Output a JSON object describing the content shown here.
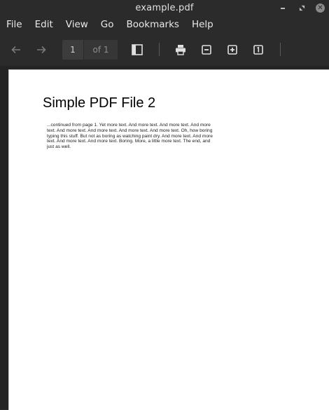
{
  "window": {
    "title": "example.pdf"
  },
  "menu": [
    "File",
    "Edit",
    "View",
    "Go",
    "Bookmarks",
    "Help"
  ],
  "toolbar": {
    "page_current": "1",
    "page_total": "of 1",
    "icons": [
      "back-arrow-icon",
      "forward-arrow-icon",
      "sidebar-toggle-icon",
      "print-icon",
      "zoom-out-icon",
      "zoom-in-icon",
      "fit-page-icon"
    ]
  },
  "document": {
    "heading": "Simple PDF File 2",
    "body": "...continued from page 1. Yet more text. And more text. And more text. And more text. And more text. And more text. And more text. And more text. Oh, how boring typing this stuff. But not as boring as watching paint dry. And more text. And more text. And more text. And more text. Boring.  More, a little more text. The end, and just as well."
  }
}
